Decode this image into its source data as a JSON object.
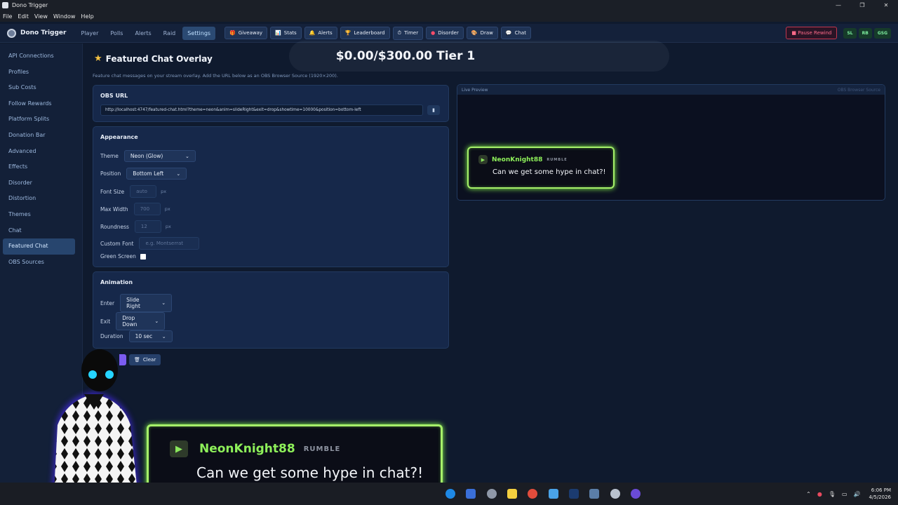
{
  "window": {
    "title": "Dono Trigger",
    "controls": [
      "—",
      "❐",
      "✕"
    ]
  },
  "menu": [
    "File",
    "Edit",
    "View",
    "Window",
    "Help"
  ],
  "brand": {
    "name": "Dono Trigger"
  },
  "nav_tabs": [
    "Player",
    "Polls",
    "Alerts",
    "Raid",
    "Settings"
  ],
  "nav_active": "Settings",
  "pills": [
    {
      "icon": "🎁",
      "label": "Giveaway"
    },
    {
      "icon": "📊",
      "label": "Stats"
    },
    {
      "icon": "🔔",
      "label": "Alerts"
    },
    {
      "icon": "🏆",
      "label": "Leaderboard"
    },
    {
      "icon": "⏱",
      "label": "Timer"
    },
    {
      "icon": "●",
      "label": "Disorder"
    },
    {
      "icon": "🎨",
      "label": "Draw"
    },
    {
      "icon": "💬",
      "label": "Chat"
    }
  ],
  "right_actions": {
    "pause": "Pause Rewind",
    "badges": [
      "SL",
      "RB",
      "GSG"
    ]
  },
  "sidebar": [
    "API Connections",
    "Profiles",
    "Sub Costs",
    "Follow Rewards",
    "Platform Splits",
    "Donation Bar",
    "Advanced",
    "Effects",
    "Disorder",
    "Distortion",
    "Themes",
    "Chat",
    "Featured Chat",
    "OBS Sources"
  ],
  "sidebar_active": "Featured Chat",
  "goal_banner": "$0.00/$300.00 Tier 1",
  "page": {
    "title": "Featured Chat Overlay",
    "description": "Feature chat messages on your stream overlay. Add the URL below as an OBS Browser Source (1920×200)."
  },
  "obs": {
    "title": "OBS URL",
    "url": "http://localhost:4747/featured-chat.html?theme=neon&anim=slideRight&exit=drop&showtime=10000&position=bottom-left"
  },
  "appearance": {
    "title": "Appearance",
    "theme_label": "Theme",
    "theme_value": "Neon (Glow)",
    "position_label": "Position",
    "position_value": "Bottom Left",
    "font_size_label": "Font Size",
    "font_size_placeholder": "auto",
    "font_size_unit": "px",
    "max_width_label": "Max Width",
    "max_width_placeholder": "700",
    "max_width_unit": "px",
    "roundness_label": "Roundness",
    "roundness_placeholder": "12",
    "roundness_unit": "px",
    "custom_font_label": "Custom Font",
    "custom_font_placeholder": "e.g. Montserrat",
    "green_screen_label": "Green Screen"
  },
  "animation": {
    "title": "Animation",
    "enter_label": "Enter",
    "enter_value": "Slide Right",
    "exit_label": "Exit",
    "exit_value": "Drop Down",
    "duration_label": "Duration",
    "duration_value": "10 sec"
  },
  "actions": {
    "clear": "Clear"
  },
  "preview": {
    "title": "Live Preview",
    "right": "OBS Browser Source"
  },
  "chat": {
    "username": "NeonKnight88",
    "platform": "RUMBLE",
    "message": "Can we get some hype in chat?!"
  },
  "tray": {
    "time": "6:06 PM",
    "date": "4/5/2026"
  }
}
